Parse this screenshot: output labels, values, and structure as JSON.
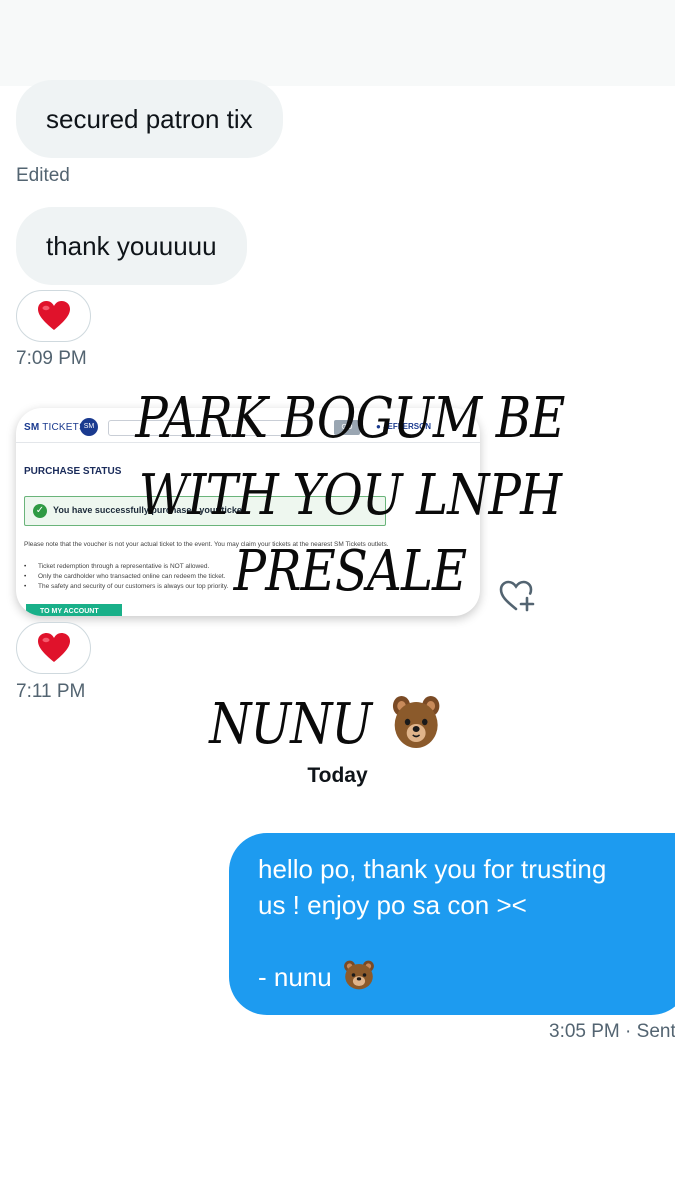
{
  "messages": {
    "patron": "secured patron tix",
    "edited": "Edited",
    "thanks": "thank youuuuu",
    "time1": "7:09 PM",
    "time2": "7:11 PM"
  },
  "reaction": {
    "icon": "red-heart",
    "color": "#e0122b"
  },
  "shared_screenshot": {
    "logo_bold": "SM",
    "logo_rest": " TICKETS",
    "go": "GO",
    "user": "JEFFERSON",
    "purchase_status": "PURCHASE STATUS",
    "success_text": "You have successfully purchased your ticket.",
    "note": "Please note that the voucher is not your actual ticket to the event. You may claim your tickets at the nearest SM Tickets outlets.",
    "bullets": [
      "Ticket redemption through a representative is NOT allowed.",
      "Only the cardholder who transacted online can redeem the ticket.",
      "The safety and security of our customers is always our top priority."
    ],
    "button": "TO MY ACCOUNT"
  },
  "overlay": {
    "line1": "PARK BOGUM BE",
    "line2": "WITH YOU LNPH",
    "line3": "PRESALE",
    "signature": "NUNU"
  },
  "divider": {
    "day": "Today"
  },
  "sent": {
    "line1": "hello po, thank you for trusting",
    "line2": "us ! enjoy po sa con ><",
    "line3": "- nunu",
    "time": "3:05 PM · Sent",
    "color": "#1d9bf0"
  }
}
